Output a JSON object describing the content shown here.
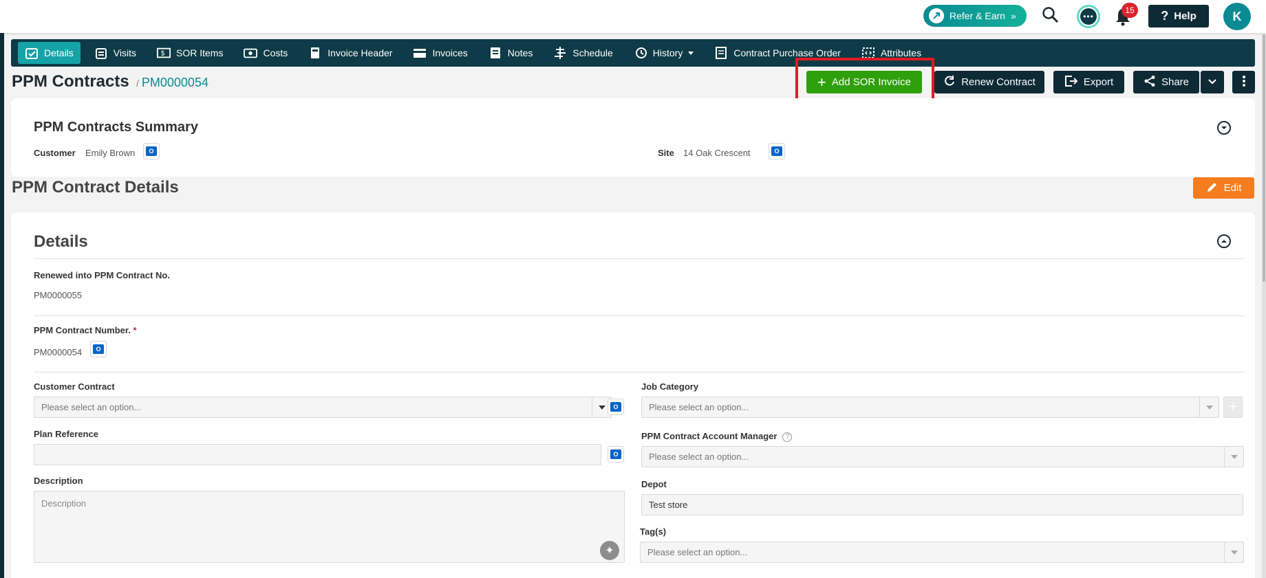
{
  "header": {
    "refer_label": "Refer & Earn",
    "notification_count": "15",
    "help_label": "Help",
    "avatar_initial": "K"
  },
  "tabs": [
    {
      "label": "Details",
      "icon": "details-icon",
      "active": true
    },
    {
      "label": "Visits",
      "icon": "calendar-icon"
    },
    {
      "label": "SOR Items",
      "icon": "sor-items-icon"
    },
    {
      "label": "Costs",
      "icon": "costs-icon"
    },
    {
      "label": "Invoice Header",
      "icon": "invoice-header-icon"
    },
    {
      "label": "Invoices",
      "icon": "card-icon"
    },
    {
      "label": "Notes",
      "icon": "notes-icon"
    },
    {
      "label": "Schedule",
      "icon": "schedule-icon"
    },
    {
      "label": "History",
      "icon": "history-icon"
    },
    {
      "label": "Contract Purchase Order",
      "icon": "purchase-order-icon"
    },
    {
      "label": "Attributes",
      "icon": "attributes-icon"
    }
  ],
  "page": {
    "title": "PPM Contracts",
    "record_id": "PM0000054"
  },
  "actions": {
    "add_sor_invoice": "Add SOR Invoice",
    "renew_contract": "Renew Contract",
    "export": "Export",
    "share": "Share",
    "edit": "Edit"
  },
  "summary": {
    "title": "PPM Contracts Summary",
    "customer_label": "Customer",
    "customer_value": "Emily Brown",
    "site_label": "Site",
    "site_value": "14 Oak Crescent"
  },
  "details_section_title": "PPM Contract Details",
  "details": {
    "card_title": "Details",
    "renewed_label": "Renewed into PPM Contract No.",
    "renewed_value": "PM0000055",
    "contract_number_label": "PPM Contract Number.",
    "contract_number_value": "PM0000054",
    "customer_contract_label": "Customer Contract",
    "customer_contract_placeholder": "Please select an option...",
    "plan_reference_label": "Plan Reference",
    "description_label": "Description",
    "description_placeholder": "Description",
    "job_category_label": "Job Category",
    "job_category_placeholder": "Please select an option...",
    "account_manager_label": "PPM Contract Account Manager",
    "account_manager_placeholder": "Please select an option...",
    "depot_label": "Depot",
    "depot_value": "Test store",
    "tags_label": "Tag(s)",
    "tags_placeholder": "Please select an option..."
  }
}
